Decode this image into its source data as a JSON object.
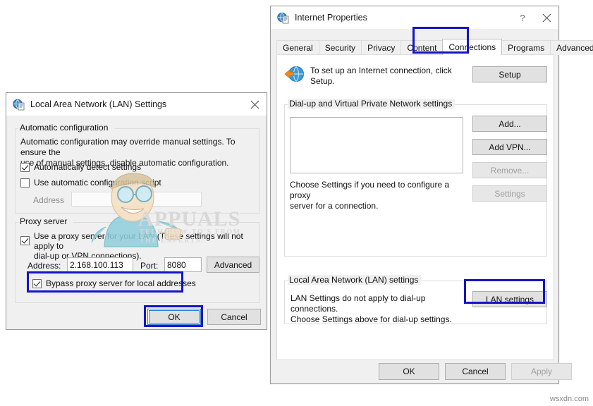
{
  "internet_properties": {
    "title": "Internet Properties",
    "icon": "globe-page-icon",
    "help_button": "?",
    "close_button": "✕",
    "tabs": [
      {
        "label": "General",
        "active": false
      },
      {
        "label": "Security",
        "active": false
      },
      {
        "label": "Privacy",
        "active": false
      },
      {
        "label": "Content",
        "active": false
      },
      {
        "label": "Connections",
        "active": true
      },
      {
        "label": "Programs",
        "active": false
      },
      {
        "label": "Advanced",
        "active": false
      }
    ],
    "setup": {
      "icon": "globe-arrow-icon",
      "text_line1": "To set up an Internet connection, click",
      "text_line2": "Setup.",
      "button": "Setup"
    },
    "dialup_group": {
      "label": "Dial-up and Virtual Private Network settings",
      "list_items": [],
      "buttons": [
        {
          "label": "Add...",
          "enabled": true
        },
        {
          "label": "Add VPN...",
          "enabled": true
        },
        {
          "label": "Remove...",
          "enabled": false
        },
        {
          "label": "Settings",
          "enabled": false
        }
      ],
      "hint_line1": "Choose Settings if you need to configure a proxy",
      "hint_line2": "server for a connection."
    },
    "lan_group": {
      "label": "Local Area Network (LAN) settings",
      "hint_line1": "LAN Settings do not apply to dial-up connections.",
      "hint_line2": "Choose Settings above for dial-up settings.",
      "button": "LAN settings"
    },
    "footer_buttons": [
      {
        "label": "OK",
        "enabled": true
      },
      {
        "label": "Cancel",
        "enabled": true
      },
      {
        "label": "Apply",
        "enabled": false
      }
    ]
  },
  "lan_settings": {
    "title": "Local Area Network (LAN) Settings",
    "icon": "globe-page-icon",
    "close_button": "✕",
    "auto_config": {
      "label": "Automatic configuration",
      "description_line1": "Automatic configuration may override manual settings.  To ensure the",
      "description_line2": "use of manual settings, disable automatic configuration.",
      "auto_detect": {
        "label": "Automatically detect settings",
        "checked": true
      },
      "use_script": {
        "label": "Use automatic configuration script",
        "checked": false
      },
      "address_label": "Address",
      "address_value": "",
      "address_enabled": false
    },
    "proxy_server": {
      "label": "Proxy server",
      "use_proxy": {
        "label_line1": "Use a proxy server for your LAN (These settings will not apply to",
        "label_line2": "dial-up or VPN connections).",
        "checked": true
      },
      "address_label": "Address:",
      "address_value": "2.168.100.113",
      "port_label": "Port:",
      "port_value": "8080",
      "advanced_button": "Advanced",
      "bypass": {
        "label": "Bypass proxy server for local addresses",
        "checked": true
      }
    },
    "footer_buttons": [
      {
        "label": "OK",
        "enabled": true,
        "focused": true
      },
      {
        "label": "Cancel",
        "enabled": true,
        "focused": false
      }
    ]
  },
  "watermark": {
    "brand": "APPUALS",
    "tagline_line1": "TECH HOW-TO'S FROM",
    "tagline_line2": "THE EXPERTS!"
  },
  "corner_tag": "wsxdn.com",
  "colors": {
    "annotation": "#1414c8",
    "dialog_face": "#f0f0f0",
    "button_face": "#e1e1e1",
    "focus_blue": "#2a7fd4"
  }
}
